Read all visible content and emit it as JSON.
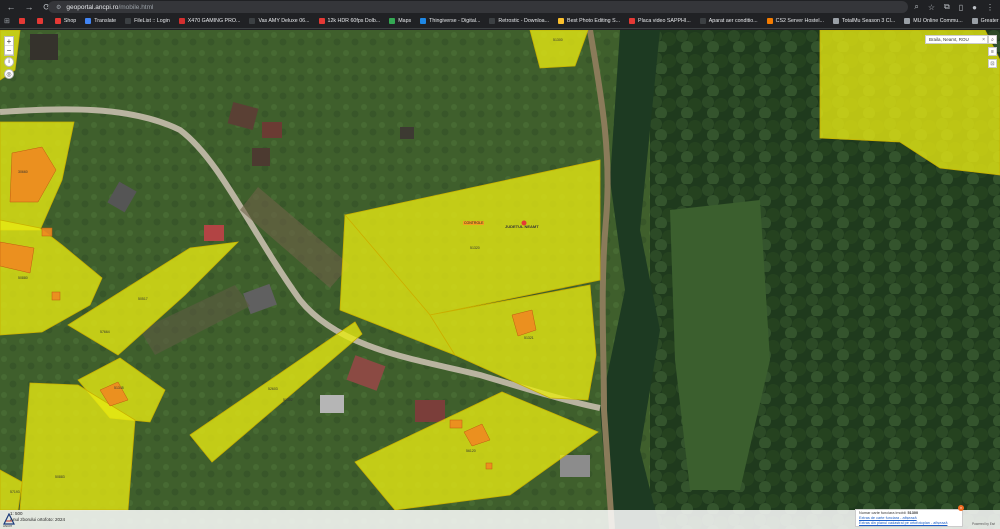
{
  "browser": {
    "url_host": "geoportal.ancpi.ro",
    "url_path": "/mobile.html",
    "bookmarks": [
      {
        "label": "",
        "color": "#e53935"
      },
      {
        "label": "",
        "color": "#e53935"
      },
      {
        "label": "Shop",
        "color": "#e53935"
      },
      {
        "label": "Translate",
        "color": "#4285f4"
      },
      {
        "label": "FileList :: Login",
        "color": "#3c4043"
      },
      {
        "label": "X470 GAMING PRO...",
        "color": "#d32f2f"
      },
      {
        "label": "Vas AMY Deluxe 06...",
        "color": "#3c4043"
      },
      {
        "label": "12k HDR 60fps Dolb...",
        "color": "#e53935"
      },
      {
        "label": "Maps",
        "color": "#34a853"
      },
      {
        "label": "Thingiverse - Digital...",
        "color": "#1e88e5"
      },
      {
        "label": "Retrostic - Downloa...",
        "color": "#3c4043"
      },
      {
        "label": "Best Photo Editing S...",
        "color": "#fbc02d"
      },
      {
        "label": "Placa video SAPPHI...",
        "color": "#e53935"
      },
      {
        "label": "Aparat aer conditio...",
        "color": "#3c4043"
      },
      {
        "label": "CS2 Server Hostel...",
        "color": "#f57c00"
      },
      {
        "label": "TotalMu Season 3 Cl...",
        "color": "#9aa0a6"
      },
      {
        "label": "MU Online Commu...",
        "color": "#9aa0a6"
      },
      {
        "label": "Greater Healing Poti...",
        "color": "#9aa0a6"
      }
    ]
  },
  "map": {
    "search_value": "Braila, Neamt, ROU",
    "zoom_in": "+",
    "zoom_out": "−",
    "scale_label": "1: 500",
    "ortho_label": "Anul zborului ortofoto: 2024",
    "brand_label": "ANCPI",
    "parcel_labels": [
      {
        "text": "51300"
      },
      {
        "text": "51320"
      },
      {
        "text": "51321"
      },
      {
        "text": "50880"
      },
      {
        "text": "30660"
      },
      {
        "text": "50517"
      },
      {
        "text": "52603"
      },
      {
        "text": "51345"
      },
      {
        "text": "51302"
      },
      {
        "text": "56120"
      },
      {
        "text": "50883"
      },
      {
        "text": "57193"
      },
      {
        "text": "57664"
      }
    ],
    "tag_label": "CONTROLE",
    "pin_label": "JUDETUL NEAMT",
    "info_panel": {
      "cf_label": "Numar carte funciara imobil:",
      "cf_number": "51300",
      "link1": "Extras de carte funciara - afișează",
      "link2": "Extras din planul cadastral pe ortofotoplan - afișează"
    },
    "powered": "Powered by Esri"
  },
  "colors": {
    "parcel_fill": "#e8ea12",
    "parcel_stroke": "#c8b000",
    "building": "#f08a20"
  }
}
